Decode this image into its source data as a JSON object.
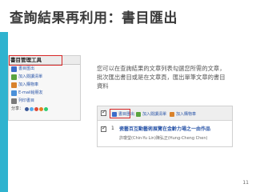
{
  "slide": {
    "title": "查詢結果再利用：書目匯出",
    "page_number": "11"
  },
  "toolbox": {
    "title": "書目管理工具",
    "items": [
      {
        "label": "書目匯出",
        "icon": "export-icon",
        "color": "#3b6cc9"
      },
      {
        "label": "加入閱讀清單",
        "icon": "reading-list-icon",
        "color": "#5aa33f"
      },
      {
        "label": "加入購物車",
        "icon": "cart-icon",
        "color": "#d9822b"
      },
      {
        "label": "E-mail給朋友",
        "icon": "email-icon",
        "color": "#4a90d9"
      },
      {
        "label": "列印書目",
        "icon": "print-icon",
        "color": "#7a7a7a"
      }
    ],
    "share_label": "分享：",
    "share_colors": [
      "#3b5998",
      "#55acee",
      "#dd4b39",
      "#e67e22",
      "#2ecc71"
    ]
  },
  "description": "您可以在查詢結果的文章列表勾選您所需的文章，批次匯出書目或是在文章頁，匯出單筆文章的書目資料",
  "results": {
    "buttons": [
      {
        "label": "書目匯出",
        "icon": "export-icon",
        "color": "#3b6cc9"
      },
      {
        "label": "加入閱讀清單",
        "icon": "reading-list-icon",
        "color": "#5aa33f"
      },
      {
        "label": "加入購物車",
        "icon": "cart-icon",
        "color": "#d9822b"
      }
    ],
    "row": {
      "number": "1",
      "title": "瓷藝百互動藝術展覽在金齡力場之一由作品",
      "author": "許瓊瑩(Chin-Yu Lin)陳弘正(Hung-Cheng Chen)"
    }
  },
  "colors": {
    "accent_stripe": "#2fb3cf",
    "highlight": "#d72626",
    "link": "#2a55a8"
  }
}
